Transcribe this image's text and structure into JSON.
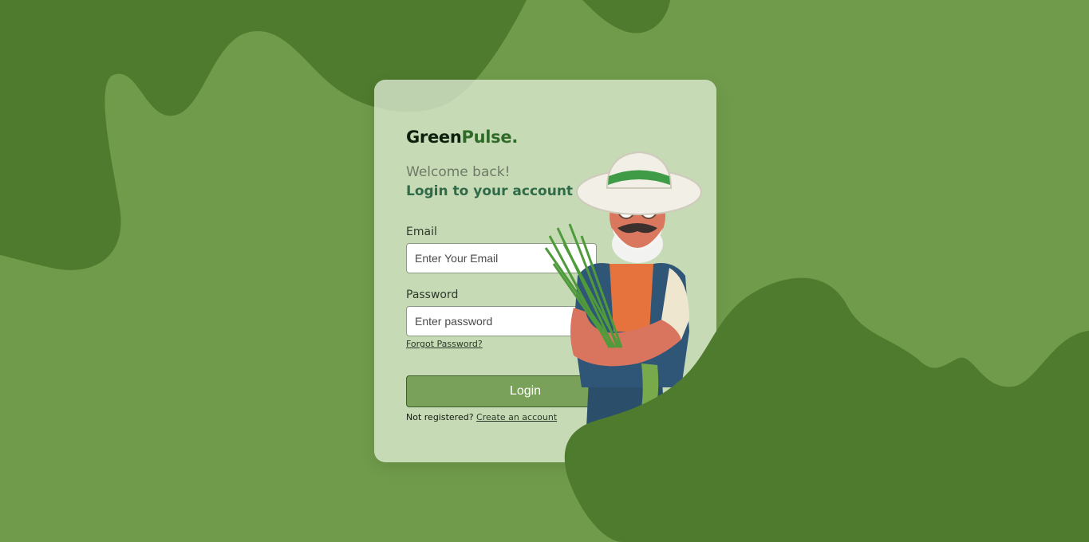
{
  "brand": {
    "part1": "Green",
    "part2": "Pulse",
    "part3": "."
  },
  "welcome": "Welcome back!",
  "heading": "Login to your account",
  "form": {
    "email_label": "Email",
    "email_placeholder": "Enter Your Email",
    "email_value": "",
    "password_label": "Password",
    "password_placeholder": "Enter password",
    "password_value": "",
    "forgot_password": "Forgot Password?",
    "login_button": "Login",
    "not_registered": "Not registered?",
    "create_account": "Create an account"
  },
  "illustration": {
    "icon": "farmer-illustration"
  },
  "colors": {
    "background": "#709b4b",
    "blob": "#4f7b2e",
    "accent": "#2f6b27",
    "button": "#7aa15a"
  }
}
